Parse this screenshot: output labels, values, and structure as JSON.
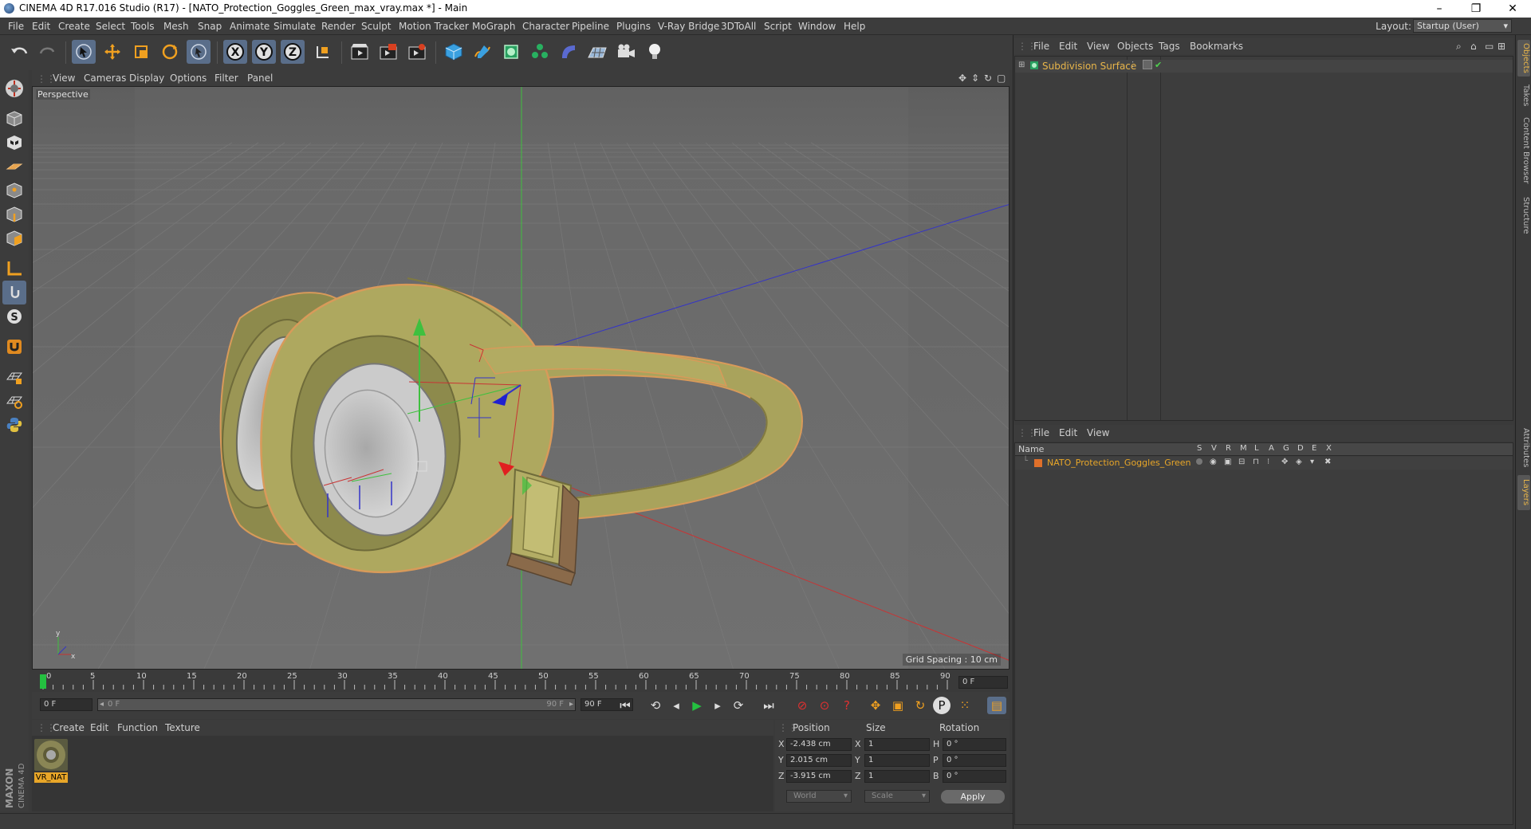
{
  "window": {
    "title": "CINEMA 4D R17.016 Studio (R17) - [NATO_Protection_Goggles_Green_max_vray.max *] - Main",
    "minimize": "–",
    "restore": "❐",
    "close": "✕"
  },
  "menu": [
    "File",
    "Edit",
    "Create",
    "Select",
    "Tools",
    "Mesh",
    "Snap",
    "Animate",
    "Simulate",
    "Render",
    "Sculpt",
    "Motion Tracker",
    "MoGraph",
    "Character",
    "Pipeline",
    "Plugins",
    "V-Ray Bridge",
    "3DToAll",
    "Script",
    "Window",
    "Help"
  ],
  "layout": {
    "label": "Layout:",
    "value": "Startup (User)"
  },
  "viewport": {
    "menu": [
      "View",
      "Cameras",
      "Display",
      "Options",
      "Filter",
      "Panel"
    ],
    "label": "Perspective",
    "grid_spacing": "Grid Spacing : 10 cm"
  },
  "timeline": {
    "ticks": [
      "0",
      "5",
      "10",
      "15",
      "20",
      "25",
      "30",
      "35",
      "40",
      "45",
      "50",
      "55",
      "60",
      "65",
      "70",
      "75",
      "80",
      "85",
      "90"
    ],
    "current_frame": "0 F",
    "start": "0 F",
    "range_start": "0 F",
    "range_end": "90 F",
    "end": "90 F"
  },
  "material": {
    "menu": [
      "Create",
      "Edit",
      "Function",
      "Texture"
    ],
    "name": "VR_NAT"
  },
  "coords": {
    "headers": {
      "position": "Position",
      "size": "Size",
      "rotation": "Rotation"
    },
    "rows": [
      {
        "axis": "X",
        "pos": "-2.438 cm",
        "saxis": "X",
        "size": "1",
        "raxis": "H",
        "rot": "0 °"
      },
      {
        "axis": "Y",
        "pos": "2.015 cm",
        "saxis": "Y",
        "size": "1",
        "raxis": "P",
        "rot": "0 °"
      },
      {
        "axis": "Z",
        "pos": "-3.915 cm",
        "saxis": "Z",
        "size": "1",
        "raxis": "B",
        "rot": "0 °"
      }
    ],
    "space": "World",
    "mode": "Scale",
    "apply": "Apply"
  },
  "branding": {
    "maxon": "MAXON",
    "c4d": "CINEMA 4D"
  },
  "objects": {
    "menu": [
      "File",
      "Edit",
      "View",
      "Objects",
      "Tags",
      "Bookmarks"
    ],
    "item": "Subdivision Surface"
  },
  "layers": {
    "menu": [
      "File",
      "Edit",
      "View"
    ],
    "head_name": "Name",
    "cols": [
      "S",
      "V",
      "R",
      "M",
      "L",
      "A",
      "G",
      "D",
      "E",
      "X"
    ],
    "item": "NATO_Protection_Goggles_Green"
  },
  "vtabs": [
    "Objects",
    "Takes",
    "Content Browser",
    "Structure",
    "Attributes",
    "Layers"
  ],
  "colors": {
    "accent": "#e8b54a",
    "selected_tool": "#5a6e8a"
  }
}
